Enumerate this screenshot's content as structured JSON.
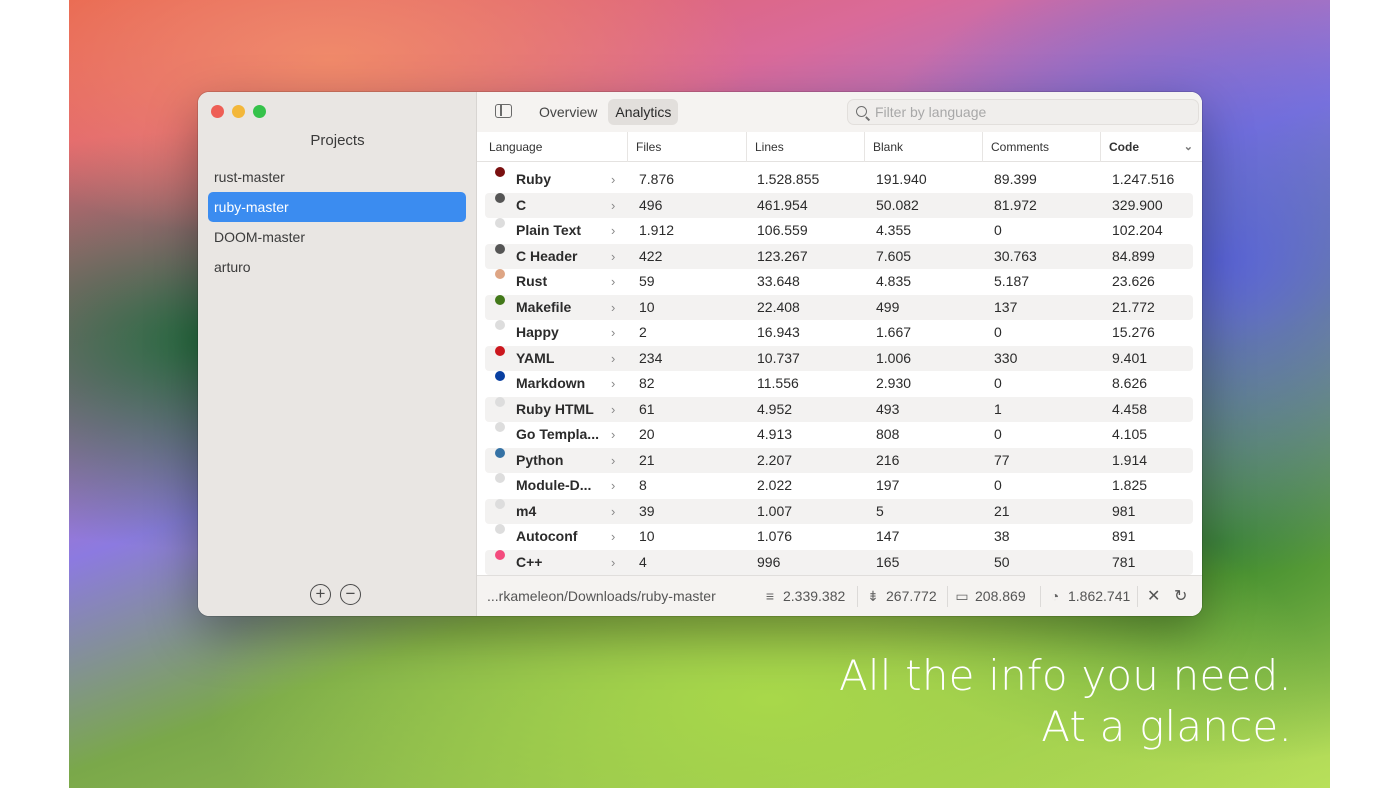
{
  "window": {
    "traffic_lights": [
      "#ee5e55",
      "#f3b73a",
      "#35c24a"
    ]
  },
  "sidebar": {
    "title": "Projects",
    "projects": [
      {
        "name": "rust-master",
        "selected": false
      },
      {
        "name": "ruby-master",
        "selected": true
      },
      {
        "name": "DOOM-master",
        "selected": false
      },
      {
        "name": "arturo",
        "selected": false
      }
    ],
    "add_icon": "plus-circle-icon",
    "remove_icon": "minus-circle-icon"
  },
  "toolbar": {
    "tabs": [
      {
        "label": "Overview",
        "selected": false
      },
      {
        "label": "Analytics",
        "selected": true
      }
    ],
    "search_placeholder": "Filter by language"
  },
  "table": {
    "columns": [
      "Language",
      "Files",
      "Lines",
      "Blank",
      "Comments",
      "Code"
    ],
    "sorted_column": "Code",
    "rows": [
      {
        "language": "Ruby",
        "color": "#7a1010",
        "files": "7.876",
        "lines": "1.528.855",
        "blank": "191.940",
        "comments": "89.399",
        "code": "1.247.516"
      },
      {
        "language": "C",
        "color": "#555555",
        "files": "496",
        "lines": "461.954",
        "blank": "50.082",
        "comments": "81.972",
        "code": "329.900"
      },
      {
        "language": "Plain Text",
        "color": "#dddddd",
        "files": "1.912",
        "lines": "106.559",
        "blank": "4.355",
        "comments": "0",
        "code": "102.204"
      },
      {
        "language": "C Header",
        "color": "#555555",
        "files": "422",
        "lines": "123.267",
        "blank": "7.605",
        "comments": "30.763",
        "code": "84.899"
      },
      {
        "language": "Rust",
        "color": "#dea584",
        "files": "59",
        "lines": "33.648",
        "blank": "4.835",
        "comments": "5.187",
        "code": "23.626"
      },
      {
        "language": "Makefile",
        "color": "#427819",
        "files": "10",
        "lines": "22.408",
        "blank": "499",
        "comments": "137",
        "code": "21.772"
      },
      {
        "language": "Happy",
        "color": "#dddddd",
        "files": "2",
        "lines": "16.943",
        "blank": "1.667",
        "comments": "0",
        "code": "15.276"
      },
      {
        "language": "YAML",
        "color": "#cb171e",
        "files": "234",
        "lines": "10.737",
        "blank": "1.006",
        "comments": "330",
        "code": "9.401"
      },
      {
        "language": "Markdown",
        "color": "#083fa1",
        "files": "82",
        "lines": "11.556",
        "blank": "2.930",
        "comments": "0",
        "code": "8.626"
      },
      {
        "language": "Ruby HTML",
        "color": "#dddddd",
        "files": "61",
        "lines": "4.952",
        "blank": "493",
        "comments": "1",
        "code": "4.458"
      },
      {
        "language": "Go Templa...",
        "color": "#dddddd",
        "files": "20",
        "lines": "4.913",
        "blank": "808",
        "comments": "0",
        "code": "4.105"
      },
      {
        "language": "Python",
        "color": "#3572a5",
        "files": "21",
        "lines": "2.207",
        "blank": "216",
        "comments": "77",
        "code": "1.914"
      },
      {
        "language": "Module-D...",
        "color": "#dddddd",
        "files": "8",
        "lines": "2.022",
        "blank": "197",
        "comments": "0",
        "code": "1.825"
      },
      {
        "language": "m4",
        "color": "#dddddd",
        "files": "39",
        "lines": "1.007",
        "blank": "5",
        "comments": "21",
        "code": "981"
      },
      {
        "language": "Autoconf",
        "color": "#dddddd",
        "files": "10",
        "lines": "1.076",
        "blank": "147",
        "comments": "38",
        "code": "891"
      },
      {
        "language": "C++",
        "color": "#f34b7d",
        "files": "4",
        "lines": "996",
        "blank": "165",
        "comments": "50",
        "code": "781"
      }
    ]
  },
  "status": {
    "path": "...rkameleon/Downloads/ruby-master",
    "lines_total": "2.339.382",
    "blank_total": "267.772",
    "comments_total": "208.869",
    "code_total": "1.862.741"
  },
  "tagline": {
    "line1": "All the info you need.",
    "line2": "At a glance."
  }
}
